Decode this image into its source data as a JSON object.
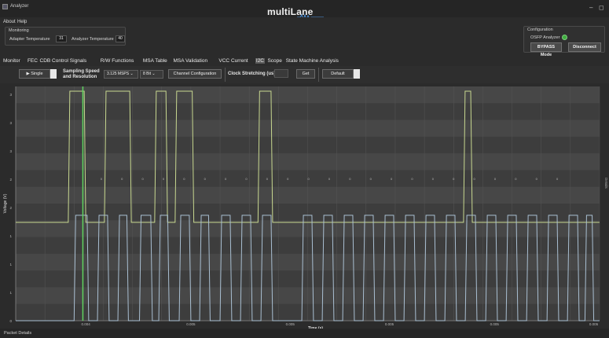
{
  "window": {
    "app_title": "Analyzer",
    "brand": "multiLane",
    "minimize": "–",
    "maximize": "◻"
  },
  "menu": [
    "About",
    "Help"
  ],
  "monitoring": {
    "title": "Monitoring",
    "adapter_label": "Adapter Temperature",
    "adapter_value": "31",
    "analyzer_label": "Analyzer Temperature",
    "analyzer_value": "40"
  },
  "configuration": {
    "title": "Configuration",
    "device_label": "OSFP Analyzer",
    "led_color": "#3fae3f",
    "bypass_label": "BYPASS Mode",
    "disconnect_label": "Disconnect"
  },
  "tabs": [
    "Monitor",
    "FEC",
    "CDB",
    "Control Signals",
    "R/W Functions",
    "MSA Table",
    "MSA Validation",
    "VCC",
    "Current",
    "I2C",
    "Scope",
    "State Machine Analysis"
  ],
  "active_tab": "I2C",
  "toolbar": {
    "run_label": "▶ Single",
    "sampling_label_1": "Sampling Speed",
    "sampling_label_2": "and Resolution",
    "speed_value": "3.125 MSPS",
    "resolution_value": "8 Bit",
    "channel_config_label": "Channel Configuration",
    "clock_stretching_label": "Clock Stretching (us)",
    "get_label": "Get",
    "default_label": "Default"
  },
  "chart_data": {
    "type": "line",
    "xlabel": "Time (s)",
    "ylabel": "Voltage (V)",
    "x_ticks": [
      "0.004",
      "0.005",
      "0.005",
      "0.005",
      "0.005",
      "0.005"
    ],
    "y_ticks": [
      "3",
      "3",
      "3",
      "2",
      "2",
      "1",
      "1",
      "1",
      "0"
    ],
    "bit_labels": [
      "0",
      "0",
      "0",
      "0",
      "0",
      "0",
      "0",
      "0",
      "0",
      "0",
      "0",
      "0",
      "0",
      "0",
      "0",
      "0",
      "0",
      "0",
      "0",
      "0",
      "0",
      "0",
      "0"
    ],
    "series": [
      {
        "color": "#c8d890",
        "baseline": 0.42,
        "high": 0.98,
        "pulses": [
          [
            0.09,
            0.12
          ],
          [
            0.152,
            0.198
          ],
          [
            0.238,
            0.26
          ],
          [
            0.273,
            0.305
          ],
          [
            0.415,
            0.44
          ],
          [
            0.767,
            0.782
          ]
        ]
      },
      {
        "color": "#a9bfd2",
        "baseline": 0.0,
        "high": 0.45,
        "pulses": [
          [
            0.1,
            0.125
          ],
          [
            0.14,
            0.16
          ],
          [
            0.175,
            0.193
          ],
          [
            0.212,
            0.234
          ],
          [
            0.245,
            0.263
          ],
          [
            0.28,
            0.3
          ],
          [
            0.315,
            0.333
          ],
          [
            0.35,
            0.37
          ],
          [
            0.385,
            0.405
          ],
          [
            0.42,
            0.44
          ],
          [
            0.49,
            0.51
          ],
          [
            0.525,
            0.545
          ],
          [
            0.56,
            0.58
          ],
          [
            0.595,
            0.615
          ],
          [
            0.63,
            0.65
          ],
          [
            0.665,
            0.685
          ],
          [
            0.7,
            0.72
          ],
          [
            0.735,
            0.755
          ],
          [
            0.77,
            0.79
          ],
          [
            0.805,
            0.825
          ],
          [
            0.84,
            0.86
          ],
          [
            0.875,
            0.895
          ],
          [
            0.91,
            0.93
          ],
          [
            0.945,
            0.965
          ],
          [
            0.975,
            0.99
          ]
        ]
      }
    ],
    "marker_color": "#5fd35f",
    "marker_x": 0.115,
    "grid": true
  },
  "side_tab": "Details",
  "status": "Packet Details"
}
